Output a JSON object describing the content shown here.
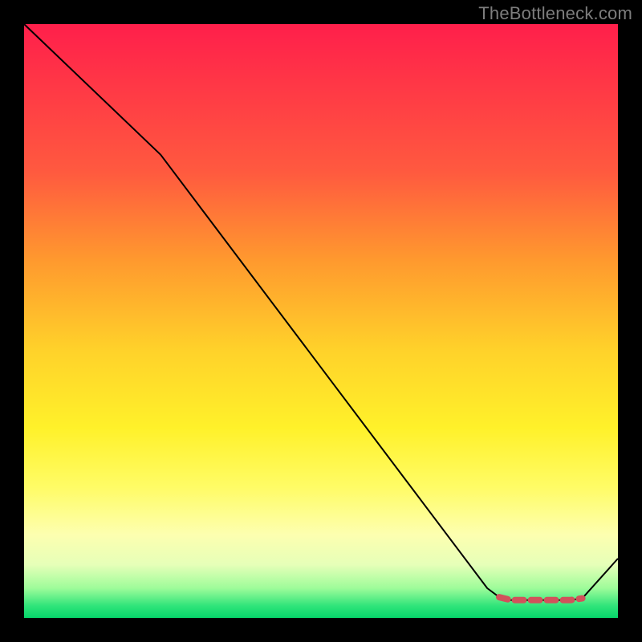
{
  "watermark": "TheBottleneck.com",
  "chart_data": {
    "type": "line",
    "title": "",
    "xlabel": "",
    "ylabel": "",
    "xlim": [
      0,
      100
    ],
    "ylim": [
      0,
      100
    ],
    "series": [
      {
        "name": "bottleneck-curve",
        "x": [
          0,
          23,
          78,
          80,
          82,
          84,
          86,
          88,
          90,
          92,
          94,
          100
        ],
        "values": [
          100,
          78,
          5,
          3.5,
          3,
          3,
          3,
          3,
          3,
          3,
          3.3,
          10
        ],
        "stroke": "#000000",
        "stroke_width": 2
      },
      {
        "name": "optimum-band",
        "x": [
          80,
          82,
          84,
          86,
          88,
          90,
          92,
          94
        ],
        "values": [
          3.5,
          3,
          3,
          3,
          3,
          3,
          3,
          3.3
        ],
        "stroke": "#d1525b",
        "stroke_width": 8,
        "dash": [
          11,
          9
        ]
      }
    ],
    "background_gradient_stops": [
      {
        "pos": 0,
        "color": "#ff1f4b"
      },
      {
        "pos": 25,
        "color": "#ff5a3f"
      },
      {
        "pos": 55,
        "color": "#ffd22a"
      },
      {
        "pos": 78,
        "color": "#fffc66"
      },
      {
        "pos": 95,
        "color": "#9efc9a"
      },
      {
        "pos": 100,
        "color": "#06d66a"
      }
    ]
  }
}
